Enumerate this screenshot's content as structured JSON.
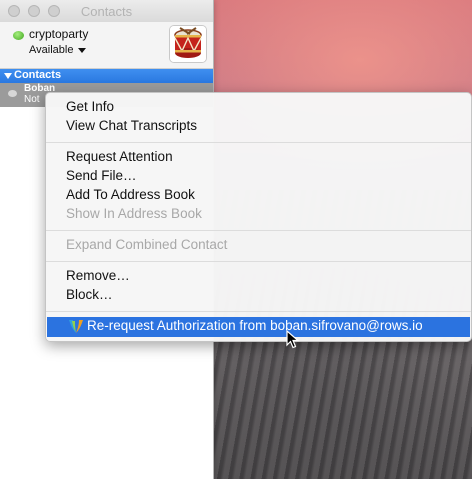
{
  "window": {
    "title": "Contacts"
  },
  "account": {
    "name": "cryptoparty",
    "availability": "Available"
  },
  "group": {
    "label": "Contacts"
  },
  "contact": {
    "name": "Boban",
    "status": "Not"
  },
  "menu": {
    "items": [
      {
        "label": "Get Info",
        "enabled": true
      },
      {
        "label": "View Chat Transcripts",
        "enabled": true
      },
      {
        "label": "Request Attention",
        "enabled": true
      },
      {
        "label": "Send File…",
        "enabled": true
      },
      {
        "label": "Add To Address Book",
        "enabled": true
      },
      {
        "label": "Show In Address Book",
        "enabled": false
      },
      {
        "label": "Expand Combined Contact",
        "enabled": false
      },
      {
        "label": "Remove…",
        "enabled": true
      },
      {
        "label": "Block…",
        "enabled": true
      },
      {
        "label": "Re-request Authorization from boban.sifrovano@rows.io",
        "enabled": true,
        "selected": true
      }
    ]
  },
  "colors": {
    "selection": "#2b73e0",
    "group_header": "#3486ea",
    "status_available": "#5cc23a",
    "disabled_text": "#a8a8a8"
  },
  "icons": {
    "protocol": "xmpp-protocol-icon",
    "status": "status-available-icon",
    "avatar": "drum-avatar-icon",
    "cursor": "mouse-pointer-icon"
  }
}
